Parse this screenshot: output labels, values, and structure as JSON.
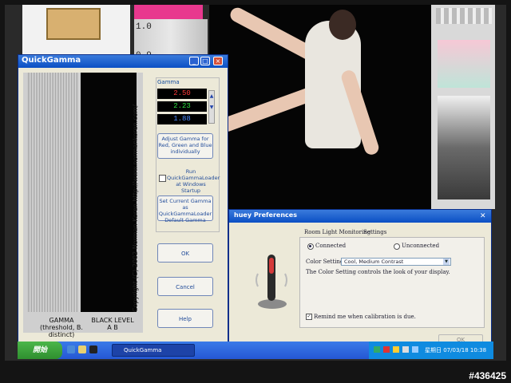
{
  "desktop": {
    "chart_label_top": "1.0",
    "chart_label_bottom": "0.9",
    "camera_caption": "#436425"
  },
  "quickgamma": {
    "title": "QuickGamma",
    "side_text": "Copyright (C) 2002    Norman Koren    http://www.normankoren.com/",
    "gamma_label": "GAMMA (threshold, B. distinct)",
    "black_label": "BLACK LEVEL A B",
    "panel_title": "Gamma",
    "gamma_red": "2.50",
    "gamma_green": "2.23",
    "gamma_blue": "1.88",
    "adjust_label": "Adjust Gamma for Red, Green and Blue individually",
    "run_label": "Run QuickGammaLoader at Windows Startup",
    "setcur_label": "Set Current Gamma as QuickGammaLoader Default Gamma",
    "ok_label": "OK",
    "cancel_label": "Cancel",
    "help_label": "Help",
    "colors": {
      "red": "#ff3a3a",
      "green": "#30e040",
      "blue": "#4d8cff"
    }
  },
  "huey": {
    "title": "huey Preferences",
    "tab_room": "Room Light Monitoring",
    "tab_settings": "Settings",
    "connected_label": "Connected",
    "unconnected_label": "Unconnected",
    "color_setting_label": "Color Setting:",
    "color_setting_value": "Cool, Medium Contrast",
    "description": "The Color Setting controls the look of your display.",
    "remind_label": "Remind me when calibration is due.",
    "ok_label": "OK"
  },
  "taskbar": {
    "start_label": "開始",
    "task_quickgamma": "QuickGamma",
    "clock": "星期日 07/03/18 10:38"
  }
}
